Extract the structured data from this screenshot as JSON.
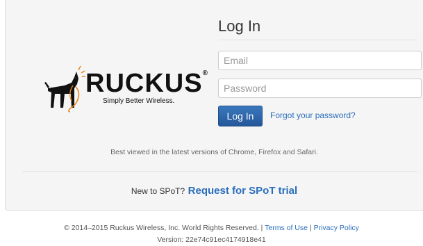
{
  "brand": {
    "name": "RUCKUS",
    "tagline": "Simply Better Wireless.",
    "registered_mark": "®",
    "accent_color": "#e8851d"
  },
  "login": {
    "title": "Log In",
    "email_placeholder": "Email",
    "password_placeholder": "Password",
    "submit_label": "Log In",
    "forgot_label": "Forgot your password?"
  },
  "browser_note": "Best viewed in the latest versions of Chrome, Firefox and Safari.",
  "trial": {
    "prefix": "New to SPoT?",
    "link_label": "Request for SPoT trial"
  },
  "footer": {
    "copyright": "© 2014–2015 Ruckus Wireless, Inc. World Rights Reserved. |",
    "terms_label": "Terms of Use",
    "separator": "|",
    "privacy_label": "Privacy Policy",
    "version": "Version: 22e74c91ec4174918e41"
  },
  "colors": {
    "primary_button": "#2d67ab",
    "link": "#2a6ebb",
    "card_background": "#f5f5f5"
  }
}
